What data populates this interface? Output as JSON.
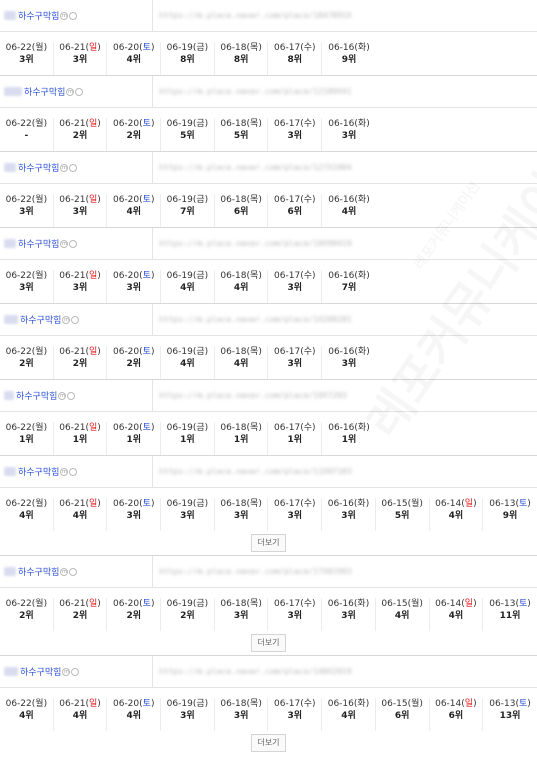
{
  "name_label": "하수구막힘",
  "badge_label": "m",
  "more_label": "더보기",
  "watermark": "레포커뮤니케이션",
  "blocks": [
    {
      "url": "https://m.place.naver.com/place/1847891X",
      "days": [
        {
          "date": "06-22",
          "dow": "월",
          "rank": "3위"
        },
        {
          "date": "06-21",
          "dow": "일",
          "rank": "3위"
        },
        {
          "date": "06-20",
          "dow": "토",
          "rank": "4위"
        },
        {
          "date": "06-19",
          "dow": "금",
          "rank": "8위"
        },
        {
          "date": "06-18",
          "dow": "목",
          "rank": "8위"
        },
        {
          "date": "06-17",
          "dow": "수",
          "rank": "8위"
        },
        {
          "date": "06-16",
          "dow": "화",
          "rank": "9위"
        }
      ]
    },
    {
      "url": "https://m.place.naver.com/place/12189X41",
      "days": [
        {
          "date": "06-22",
          "dow": "월",
          "rank": "-"
        },
        {
          "date": "06-21",
          "dow": "일",
          "rank": "2위"
        },
        {
          "date": "06-20",
          "dow": "토",
          "rank": "2위"
        },
        {
          "date": "06-19",
          "dow": "금",
          "rank": "5위"
        },
        {
          "date": "06-18",
          "dow": "목",
          "rank": "5위"
        },
        {
          "date": "06-17",
          "dow": "수",
          "rank": "3위"
        },
        {
          "date": "06-16",
          "dow": "화",
          "rank": "3위"
        }
      ]
    },
    {
      "url": "https://m.place.naver.com/place/127X1904",
      "days": [
        {
          "date": "06-22",
          "dow": "월",
          "rank": "3위"
        },
        {
          "date": "06-21",
          "dow": "일",
          "rank": "3위"
        },
        {
          "date": "06-20",
          "dow": "토",
          "rank": "4위"
        },
        {
          "date": "06-19",
          "dow": "금",
          "rank": "7위"
        },
        {
          "date": "06-18",
          "dow": "목",
          "rank": "6위"
        },
        {
          "date": "06-17",
          "dow": "수",
          "rank": "6위"
        },
        {
          "date": "06-16",
          "dow": "화",
          "rank": "4위"
        }
      ]
    },
    {
      "url": "https://m.place.naver.com/place/18X90419",
      "days": [
        {
          "date": "06-22",
          "dow": "월",
          "rank": "3위"
        },
        {
          "date": "06-21",
          "dow": "일",
          "rank": "3위"
        },
        {
          "date": "06-20",
          "dow": "토",
          "rank": "3위"
        },
        {
          "date": "06-19",
          "dow": "금",
          "rank": "4위"
        },
        {
          "date": "06-18",
          "dow": "목",
          "rank": "4위"
        },
        {
          "date": "06-17",
          "dow": "수",
          "rank": "3위"
        },
        {
          "date": "06-16",
          "dow": "화",
          "rank": "7위"
        }
      ]
    },
    {
      "url": "https://m.place.naver.com/place/1X209281",
      "days": [
        {
          "date": "06-22",
          "dow": "월",
          "rank": "2위"
        },
        {
          "date": "06-21",
          "dow": "일",
          "rank": "2위"
        },
        {
          "date": "06-20",
          "dow": "토",
          "rank": "2위"
        },
        {
          "date": "06-19",
          "dow": "금",
          "rank": "4위"
        },
        {
          "date": "06-18",
          "dow": "목",
          "rank": "4위"
        },
        {
          "date": "06-17",
          "dow": "수",
          "rank": "3위"
        },
        {
          "date": "06-16",
          "dow": "화",
          "rank": "3위"
        }
      ]
    },
    {
      "url": "https://m.place.naver.com/place/19X7203",
      "days": [
        {
          "date": "06-22",
          "dow": "월",
          "rank": "1위"
        },
        {
          "date": "06-21",
          "dow": "일",
          "rank": "1위"
        },
        {
          "date": "06-20",
          "dow": "토",
          "rank": "1위"
        },
        {
          "date": "06-19",
          "dow": "금",
          "rank": "1위"
        },
        {
          "date": "06-18",
          "dow": "목",
          "rank": "1위"
        },
        {
          "date": "06-17",
          "dow": "수",
          "rank": "1위"
        },
        {
          "date": "06-16",
          "dow": "화",
          "rank": "1위"
        }
      ]
    },
    {
      "url": "https://m.place.naver.com/place/11X97183",
      "days": [
        {
          "date": "06-22",
          "dow": "월",
          "rank": "4위"
        },
        {
          "date": "06-21",
          "dow": "일",
          "rank": "4위"
        },
        {
          "date": "06-20",
          "dow": "토",
          "rank": "3위"
        },
        {
          "date": "06-19",
          "dow": "금",
          "rank": "3위"
        },
        {
          "date": "06-18",
          "dow": "목",
          "rank": "3위"
        },
        {
          "date": "06-17",
          "dow": "수",
          "rank": "3위"
        },
        {
          "date": "06-16",
          "dow": "화",
          "rank": "3위"
        },
        {
          "date": "06-15",
          "dow": "월",
          "rank": "5위"
        },
        {
          "date": "06-14",
          "dow": "일",
          "rank": "4위"
        },
        {
          "date": "06-13",
          "dow": "토",
          "rank": "9위"
        }
      ],
      "has_more": true
    },
    {
      "url": "https://m.place.naver.com/place/17X81993",
      "days": [
        {
          "date": "06-22",
          "dow": "월",
          "rank": "2위"
        },
        {
          "date": "06-21",
          "dow": "일",
          "rank": "2위"
        },
        {
          "date": "06-20",
          "dow": "토",
          "rank": "2위"
        },
        {
          "date": "06-19",
          "dow": "금",
          "rank": "2위"
        },
        {
          "date": "06-18",
          "dow": "목",
          "rank": "3위"
        },
        {
          "date": "06-17",
          "dow": "수",
          "rank": "3위"
        },
        {
          "date": "06-16",
          "dow": "화",
          "rank": "3위"
        },
        {
          "date": "06-15",
          "dow": "월",
          "rank": "4위"
        },
        {
          "date": "06-14",
          "dow": "일",
          "rank": "4위"
        },
        {
          "date": "06-13",
          "dow": "토",
          "rank": "11위"
        }
      ],
      "has_more": true
    },
    {
      "url": "https://m.place.naver.com/place/148X2019",
      "days": [
        {
          "date": "06-22",
          "dow": "월",
          "rank": "4위"
        },
        {
          "date": "06-21",
          "dow": "일",
          "rank": "4위"
        },
        {
          "date": "06-20",
          "dow": "토",
          "rank": "4위"
        },
        {
          "date": "06-19",
          "dow": "금",
          "rank": "3위"
        },
        {
          "date": "06-18",
          "dow": "목",
          "rank": "3위"
        },
        {
          "date": "06-17",
          "dow": "수",
          "rank": "3위"
        },
        {
          "date": "06-16",
          "dow": "화",
          "rank": "4위"
        },
        {
          "date": "06-15",
          "dow": "월",
          "rank": "6위"
        },
        {
          "date": "06-14",
          "dow": "일",
          "rank": "6위"
        },
        {
          "date": "06-13",
          "dow": "토",
          "rank": "13위"
        }
      ],
      "has_more": true
    }
  ]
}
